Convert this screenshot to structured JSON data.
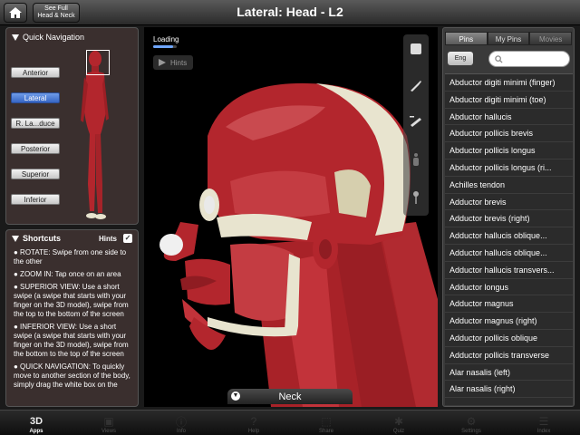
{
  "header": {
    "see_full_line1": "See Full",
    "see_full_line2": "Head & Neck",
    "title": "Lateral: Head - L2"
  },
  "quick_navigation": {
    "title": "Quick Navigation",
    "items": [
      {
        "label": "Anterior",
        "active": false
      },
      {
        "label": "Lateral",
        "active": true
      },
      {
        "label": "R. La...duce",
        "active": false
      },
      {
        "label": "Posterior",
        "active": false
      },
      {
        "label": "Superior",
        "active": false
      },
      {
        "label": "Inferior",
        "active": false
      }
    ]
  },
  "shortcuts": {
    "title": "Shortcuts",
    "hints_label": "Hints",
    "hints_checked": true,
    "items": [
      "● ROTATE: Swipe from one side to the other",
      "● ZOOM IN: Tap once on an area",
      "● SUPERIOR VIEW: Use a short swipe (a swipe that starts with your finger on the 3D model), swipe from the top to the bottom of the screen",
      "● INFERIOR VIEW: Use a short swipe (a swipe that starts with your finger on the 3D model), swipe from the bottom to the top of the screen",
      "● QUICK NAVIGATION: To quickly move to another section of the body, simply drag the white box on the"
    ]
  },
  "viewer": {
    "loading_label": "Loading",
    "loading_progress": 0.85,
    "hints_button": "Hints",
    "bottom_label": "Neck"
  },
  "right_panel": {
    "tabs": [
      {
        "label": "Pins",
        "active": true
      },
      {
        "label": "My Pins",
        "active": false
      },
      {
        "label": "Movies",
        "active": false
      }
    ],
    "language_button": "Eng",
    "search_placeholder": "",
    "muscles": [
      "Abductor digiti minimi (finger)",
      "Abductor digiti minimi (toe)",
      "Abductor hallucis",
      "Abductor pollicis brevis",
      "Abductor pollicis longus",
      "Abductor pollicis longus (ri...",
      "Achilles tendon",
      "Adductor brevis",
      "Adductor brevis (right)",
      "Adductor hallucis oblique...",
      "Adductor hallucis oblique...",
      "Adductor hallucis transvers...",
      "Adductor longus",
      "Adductor magnus",
      "Adductor magnus (right)",
      "Adductor pollicis oblique",
      "Adductor pollicis transverse",
      "Alar nasalis (left)",
      "Alar nasalis (right)"
    ]
  },
  "bottom_bar": {
    "items": [
      {
        "label": "Apps",
        "icon": "3d-icon",
        "active": true
      },
      {
        "label": "Views",
        "icon": "views-icon",
        "active": false
      },
      {
        "label": "Info",
        "icon": "info-icon",
        "active": false
      },
      {
        "label": "Help",
        "icon": "help-icon",
        "active": false
      },
      {
        "label": "Share",
        "icon": "share-icon",
        "active": false
      },
      {
        "label": "Quiz",
        "icon": "quiz-icon",
        "active": false
      },
      {
        "label": "Settings",
        "icon": "gear-icon",
        "active": false
      },
      {
        "label": "Index",
        "icon": "index-icon",
        "active": false
      }
    ]
  },
  "colors": {
    "accent": "#3766c4",
    "muscle_red": "#b3262d",
    "bone": "#e8e4cf"
  }
}
